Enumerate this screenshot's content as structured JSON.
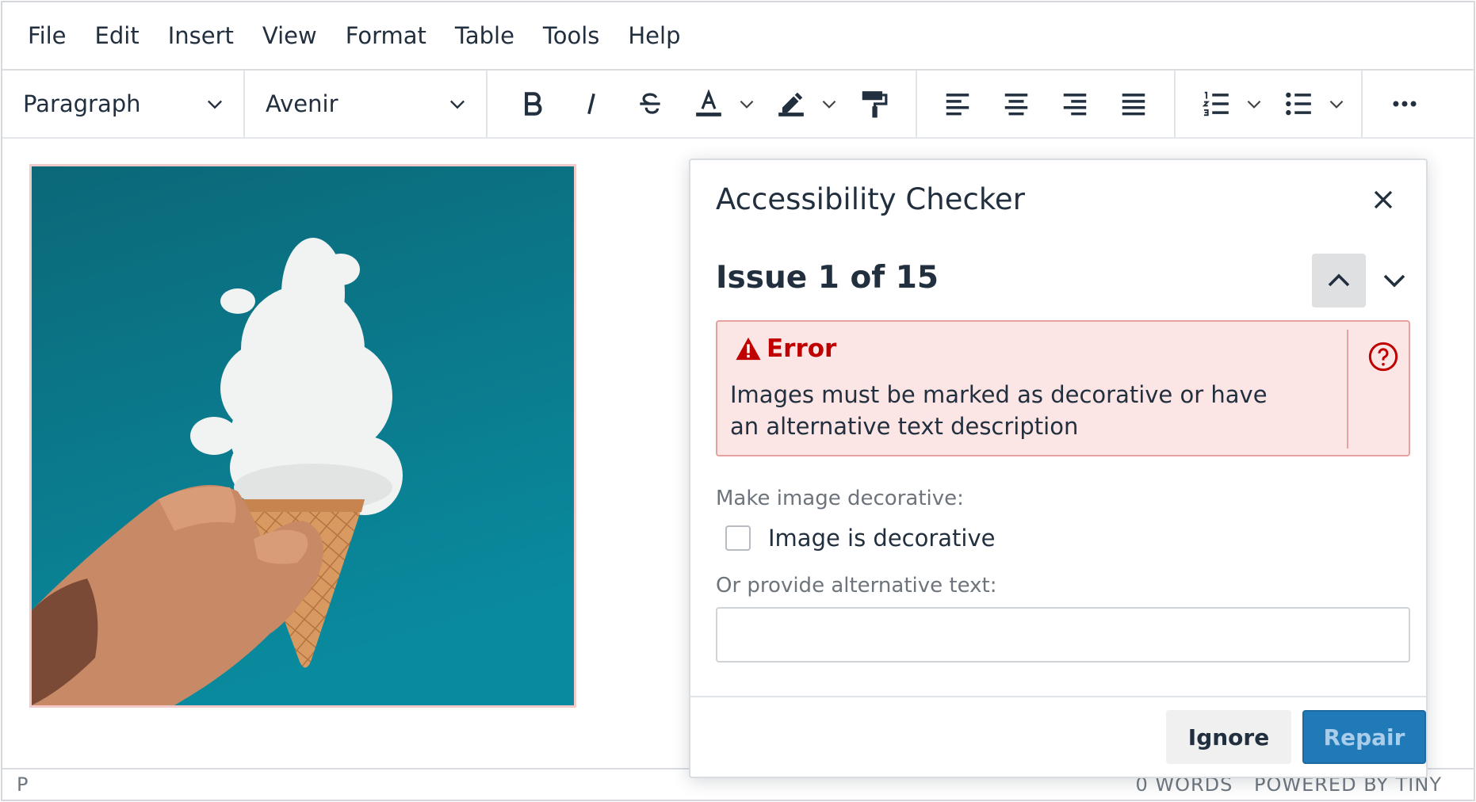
{
  "menubar": {
    "items": [
      "File",
      "Edit",
      "Insert",
      "View",
      "Format",
      "Table",
      "Tools",
      "Help"
    ]
  },
  "toolbar": {
    "block_format": "Paragraph",
    "font_family": "Avenir",
    "icons": [
      "bold-icon",
      "italic-icon",
      "strikethrough-icon",
      "text-color-icon",
      "highlight-icon",
      "format-painter-icon",
      "align-left-icon",
      "align-center-icon",
      "align-right-icon",
      "align-justify-icon",
      "numbered-list-icon",
      "bullet-list-icon",
      "more-icon"
    ],
    "colors": {
      "text_color": "#222f3e",
      "highlight": "#222f3e"
    }
  },
  "statusbar": {
    "path": "P",
    "word_count": "0 WORDS",
    "branding": "POWERED BY TINY"
  },
  "checker": {
    "title": "Accessibility Checker",
    "issue_count": "Issue 1 of 15",
    "severity": "Error",
    "message": "Images must be marked as decorative or have an alternative text description",
    "decorative_label": "Make image decorative:",
    "checkbox_label": "Image is decorative",
    "checkbox_checked": false,
    "alt_label": "Or provide alternative text:",
    "alt_value": "",
    "ignore_label": "Ignore",
    "repair_label": "Repair",
    "colors": {
      "error": "#c00000",
      "error_bg": "#fbe5e5",
      "primary": "#207ab7"
    }
  }
}
